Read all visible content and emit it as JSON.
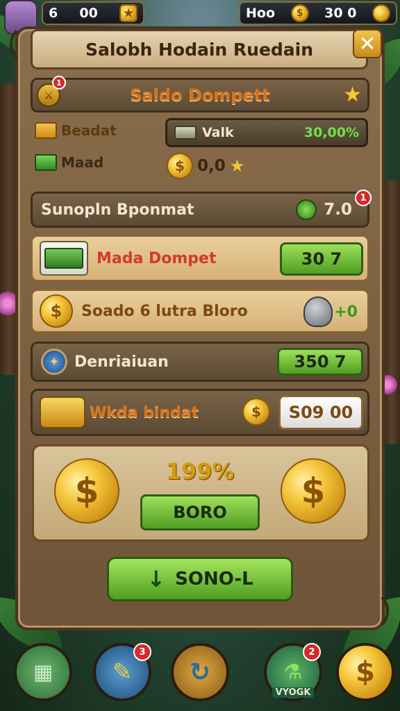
{
  "hud": {
    "left_value_1": "6",
    "left_value_2": "00",
    "right_label": "Hoo",
    "right_value": "30 0"
  },
  "title": "Salobh Hodain Ruedain",
  "wallet_header": {
    "label": "Saldo Dompett",
    "badge": "1"
  },
  "info_rows": [
    {
      "label": "Beadat"
    },
    {
      "label": "Maad"
    }
  ],
  "valk": {
    "label": "Valk",
    "value": "30,00%"
  },
  "coin_amount": "0,0",
  "sunopln": {
    "label": "Sunopln Bponmat",
    "value": "7.0",
    "badge": "1"
  },
  "mada": {
    "label": "Mada Dompet",
    "value": "30  7"
  },
  "soado": {
    "label": "Soado 6 lutra Bloro",
    "value": "+0"
  },
  "denriaiuan": {
    "label": "Denriaiuan",
    "value": "350  7"
  },
  "wkda": {
    "label": "Wkda bindat",
    "value": "S09  00"
  },
  "bonus": {
    "percent": "199%",
    "button_label": "BORO"
  },
  "main_button": {
    "label": "SONO-L"
  },
  "nav": [
    {
      "label": ""
    },
    {
      "label": "",
      "badge": "3"
    },
    {
      "label": ""
    },
    {
      "label": "VYOGK",
      "badge": "2"
    },
    {
      "label": ""
    }
  ],
  "colors": {
    "accent_green": "#6fc232",
    "gold": "#f5c63a",
    "frame_brown": "#6e5438",
    "badge_red": "#d42a2a"
  }
}
